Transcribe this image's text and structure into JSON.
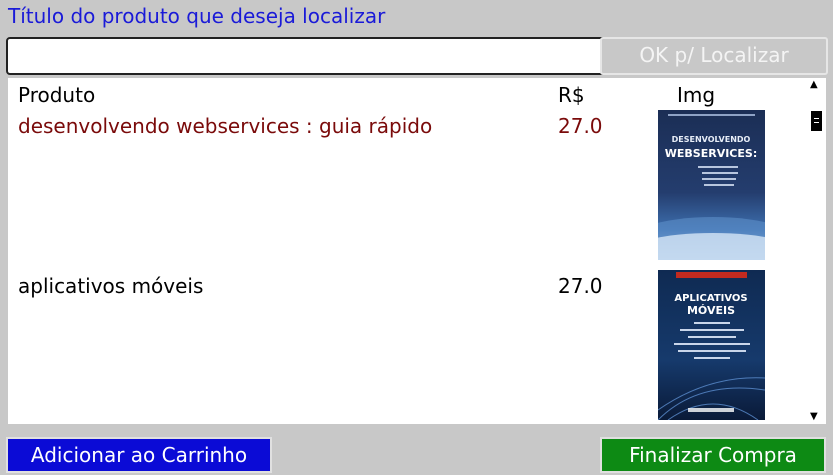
{
  "search": {
    "label": "Título do produto que deseja localizar",
    "value": "",
    "button_label": "OK p/ Localizar"
  },
  "list": {
    "headers": {
      "product": "Produto",
      "price": "R$",
      "image": "Img"
    },
    "items": [
      {
        "name": "desenvolvendo webservices : guia rápido",
        "price": "27.0",
        "cover_title": "DESENVOLVENDO WEBSERVICES:",
        "selected": true
      },
      {
        "name": "aplicativos móveis",
        "price": "27.0",
        "cover_title": "APLICATIVOS MÓVEIS",
        "selected": false
      }
    ]
  },
  "footer": {
    "add_to_cart_label": "Adicionar ao Carrinho",
    "checkout_label": "Finalizar Compra"
  },
  "colors": {
    "window_bg": "#c8c8c8",
    "label_blue": "#1a1ad8",
    "selected_text": "#7a0a0a",
    "add_button": "#0b0bd6",
    "checkout_button": "#0d8a14"
  }
}
